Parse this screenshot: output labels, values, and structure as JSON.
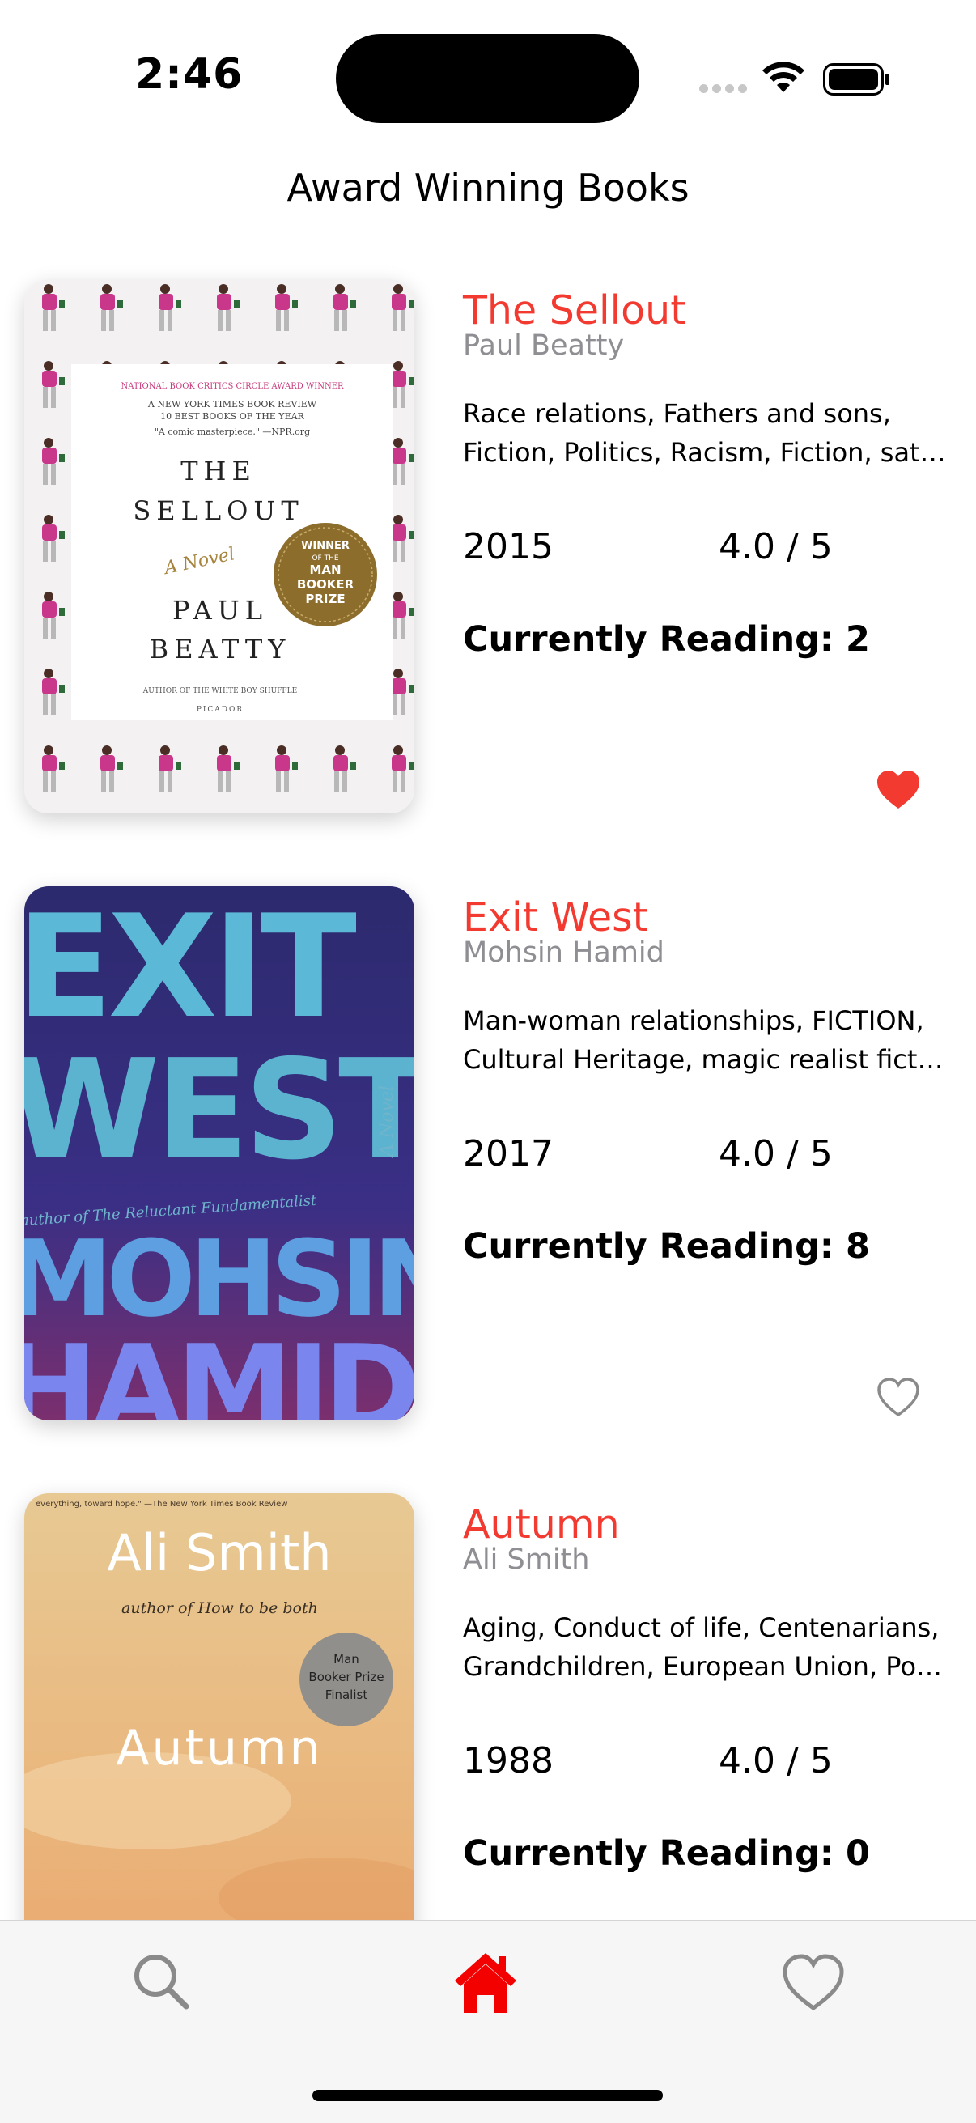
{
  "status_bar": {
    "time": "2:46"
  },
  "header": {
    "title": "Award Winning Books"
  },
  "books": [
    {
      "title": "The Sellout",
      "author": "Paul Beatty",
      "subjects_line1": "Race relations, Fathers and sons,",
      "subjects_line2": "Fiction, Politics, Racism, Fiction, satire",
      "year": "2015",
      "rating": "4.0 / 5",
      "reading": "Currently Reading: 2",
      "favorited": true,
      "cover": {
        "line1": "NATIONAL BOOK CRITICS CIRCLE AWARD WINNER",
        "line2": "A NEW YORK TIMES BOOK REVIEW",
        "line3": "10 BEST BOOKS OF THE YEAR",
        "quote": "\"A comic masterpiece.\" —NPR.org",
        "title_top": "THE",
        "title_bottom": "SELLOUT",
        "subtitle": "A Novel",
        "author_top": "PAUL",
        "author_bottom": "BEATTY",
        "seal": [
          "WINNER",
          "OF THE",
          "MAN",
          "BOOKER",
          "PRIZE"
        ],
        "byline": "AUTHOR OF THE WHITE BOY SHUFFLE",
        "publisher": "PICADOR"
      }
    },
    {
      "title": "Exit West",
      "author": "Mohsin Hamid",
      "subjects_line1": "Man-woman relationships, FICTION,",
      "subjects_line2": "Cultural Heritage, magic realist fiction",
      "year": "2017",
      "rating": "4.0 / 5",
      "reading": "Currently Reading: 8",
      "favorited": false,
      "cover": {
        "word1": "EXIT",
        "word2": "WEST",
        "word3": "MOHSIN",
        "word4": "HAMID",
        "side": "A Novel",
        "tagline": "author of The Reluctant Fundamentalist"
      }
    },
    {
      "title": "Autumn",
      "author": "Ali Smith",
      "subjects_line1": "Aging, Conduct of life, Centenarians,",
      "subjects_line2": "Grandchildren, European Union, Politics",
      "year": "1988",
      "rating": "4.0 / 5",
      "reading": "Currently Reading: 0",
      "favorited": false,
      "cover": {
        "review": "everything, toward hope.\" —The New York Times Book Review",
        "author": "Ali Smith",
        "byline": "author of How to be both",
        "badge": [
          "Man",
          "Booker Prize",
          "Finalist"
        ],
        "title": "Autumn"
      }
    }
  ],
  "tab_bar": {
    "items": [
      {
        "name": "search",
        "icon": "magnifying-glass"
      },
      {
        "name": "home",
        "icon": "house",
        "active": true
      },
      {
        "name": "favorites",
        "icon": "heart"
      }
    ]
  },
  "colors": {
    "accent": "#f33a30",
    "heart_fill": "#f33a30",
    "author_gray": "#8e8e93",
    "tab_inactive": "#8a8a8a",
    "tab_active": "#f30000"
  }
}
